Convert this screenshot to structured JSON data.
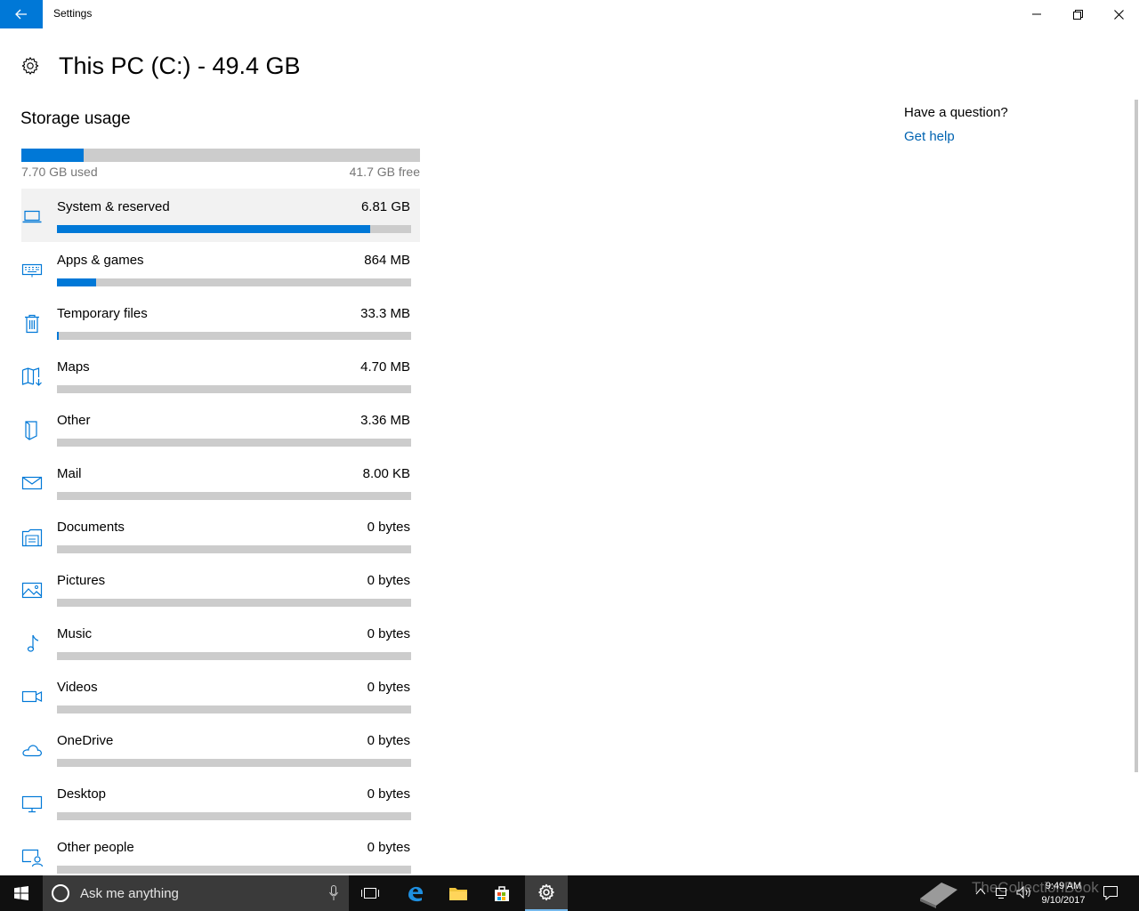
{
  "window": {
    "title": "Settings"
  },
  "header": {
    "title": "This PC (C:) - 49.4 GB"
  },
  "storage": {
    "section_title": "Storage usage",
    "used_label": "7.70 GB used",
    "free_label": "41.7 GB free",
    "used_fraction": 0.156
  },
  "categories": [
    {
      "name": "System & reserved",
      "size": "6.81 GB",
      "fraction": 0.885,
      "icon": "laptop-icon"
    },
    {
      "name": "Apps & games",
      "size": "864 MB",
      "fraction": 0.11,
      "icon": "keyboard-icon"
    },
    {
      "name": "Temporary files",
      "size": "33.3 MB",
      "fraction": 0.005,
      "icon": "trash-icon"
    },
    {
      "name": "Maps",
      "size": "4.70 MB",
      "fraction": 0,
      "icon": "map-icon"
    },
    {
      "name": "Other",
      "size": "3.36 MB",
      "fraction": 0,
      "icon": "other-icon"
    },
    {
      "name": "Mail",
      "size": "8.00 KB",
      "fraction": 0,
      "icon": "mail-icon"
    },
    {
      "name": "Documents",
      "size": "0 bytes",
      "fraction": 0,
      "icon": "documents-icon"
    },
    {
      "name": "Pictures",
      "size": "0 bytes",
      "fraction": 0,
      "icon": "pictures-icon"
    },
    {
      "name": "Music",
      "size": "0 bytes",
      "fraction": 0,
      "icon": "music-icon"
    },
    {
      "name": "Videos",
      "size": "0 bytes",
      "fraction": 0,
      "icon": "video-icon"
    },
    {
      "name": "OneDrive",
      "size": "0 bytes",
      "fraction": 0,
      "icon": "cloud-icon"
    },
    {
      "name": "Desktop",
      "size": "0 bytes",
      "fraction": 0,
      "icon": "desktop-icon"
    },
    {
      "name": "Other people",
      "size": "0 bytes",
      "fraction": 0,
      "icon": "person-icon"
    }
  ],
  "help": {
    "question": "Have a question?",
    "link": "Get help"
  },
  "taskbar": {
    "search_placeholder": "Ask me anything",
    "time": "9:49 AM",
    "date": "9/10/2017",
    "watermark": "TheCollectionBook"
  },
  "colors": {
    "accent": "#0078d7",
    "bar_bg": "#cccccc",
    "link": "#0063b1"
  }
}
